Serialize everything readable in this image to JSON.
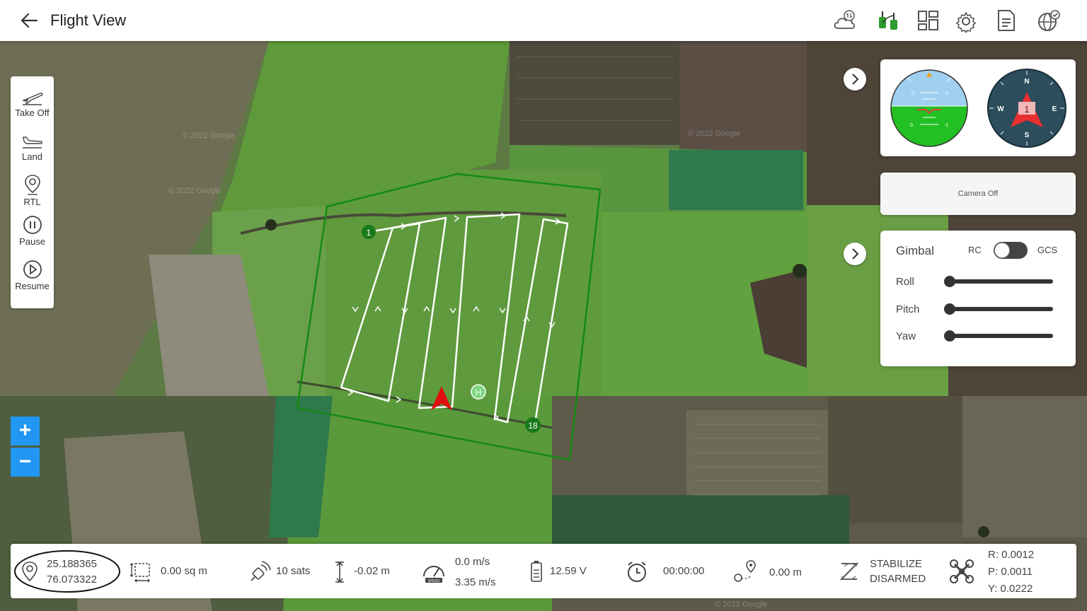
{
  "header": {
    "title": "Flight View",
    "icons": [
      "back-arrow-icon",
      "weather-icon",
      "rc-controller-icon",
      "layout-icon",
      "settings-icon",
      "document-icon",
      "globe-check-icon"
    ]
  },
  "map": {
    "waypoint_labels": [
      "1",
      "18"
    ],
    "home_label": "H",
    "watermark": "© 2022 Google"
  },
  "toolbar": {
    "takeoff": "Take Off",
    "land": "Land",
    "rtl": "RTL",
    "pause": "Pause",
    "resume": "Resume"
  },
  "zoom": {
    "in": "+",
    "out": "−"
  },
  "instruments": {
    "horizon_marks": [
      "0",
      "0",
      "0",
      "-1"
    ],
    "compass": {
      "north": "N",
      "south": "S",
      "east": "E",
      "west": "W",
      "heading": "1"
    }
  },
  "camera": {
    "status": "Camera Off"
  },
  "gimbal": {
    "title": "Gimbal",
    "mode_left": "RC",
    "mode_right": "GCS",
    "toggle_on": false,
    "sliders": [
      {
        "label": "Roll",
        "level": 0
      },
      {
        "label": "Pitch",
        "level": 0
      },
      {
        "label": "Yaw",
        "level": 0
      }
    ]
  },
  "status": {
    "lat": "25.188365",
    "lon": "76.073322",
    "area": "0.00 sq m",
    "sats": "10 sats",
    "altitude": "-0.02 m",
    "speed_vertical": "0.0 m/s",
    "speed_ground": "3.35 m/s",
    "speed_icon_text": "SPEED",
    "voltage": "12.59 V",
    "timer": "00:00:00",
    "distance": "0.00 m",
    "mode": "STABILIZE",
    "arm_state": "DISARMED",
    "roll": "R: 0.0012",
    "pitch": "P: 0.0011",
    "yaw": "Y: 0.0222"
  },
  "colors": {
    "accent": "#2196f3",
    "boundary": "#138a13",
    "waypoint": "#1a7a1a",
    "drone": "#e01010",
    "home": "#7ed67e"
  }
}
